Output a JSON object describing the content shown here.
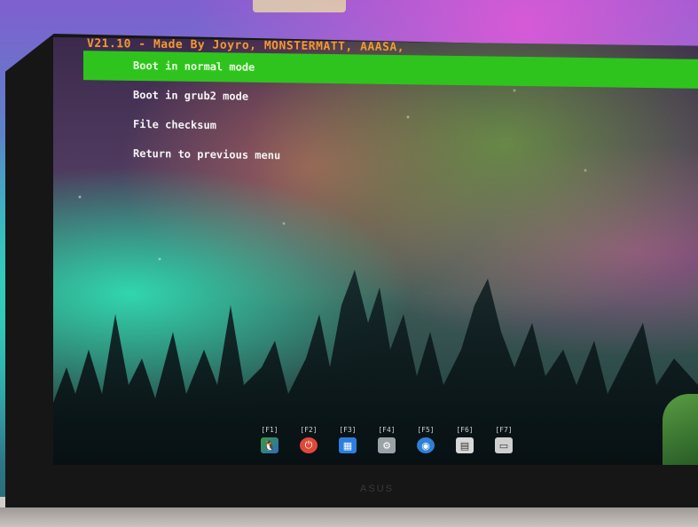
{
  "header": {
    "text": "V21.10 - Made By Joyro, MONSTERMATT, AAASA,"
  },
  "menu": {
    "items": [
      {
        "label": "Boot in normal mode",
        "selected": true
      },
      {
        "label": "Boot in grub2 mode",
        "selected": false
      },
      {
        "label": "File checksum",
        "selected": false
      },
      {
        "label": "Return to previous menu",
        "selected": false
      }
    ]
  },
  "fkeys": [
    {
      "key": "[F1]",
      "icon": "tux-icon"
    },
    {
      "key": "[F2]",
      "icon": "power-icon"
    },
    {
      "key": "[F3]",
      "icon": "grid-icon"
    },
    {
      "key": "[F4]",
      "icon": "settings-icon"
    },
    {
      "key": "[F5]",
      "icon": "disk-icon"
    },
    {
      "key": "[F6]",
      "icon": "file-icon"
    },
    {
      "key": "[F7]",
      "icon": "monitor-icon"
    }
  ],
  "monitor": {
    "brand": "ASUS"
  },
  "colors": {
    "header": "#f29a2e",
    "selection": "#2ec41d",
    "menu_text": "#f4f4f4"
  }
}
